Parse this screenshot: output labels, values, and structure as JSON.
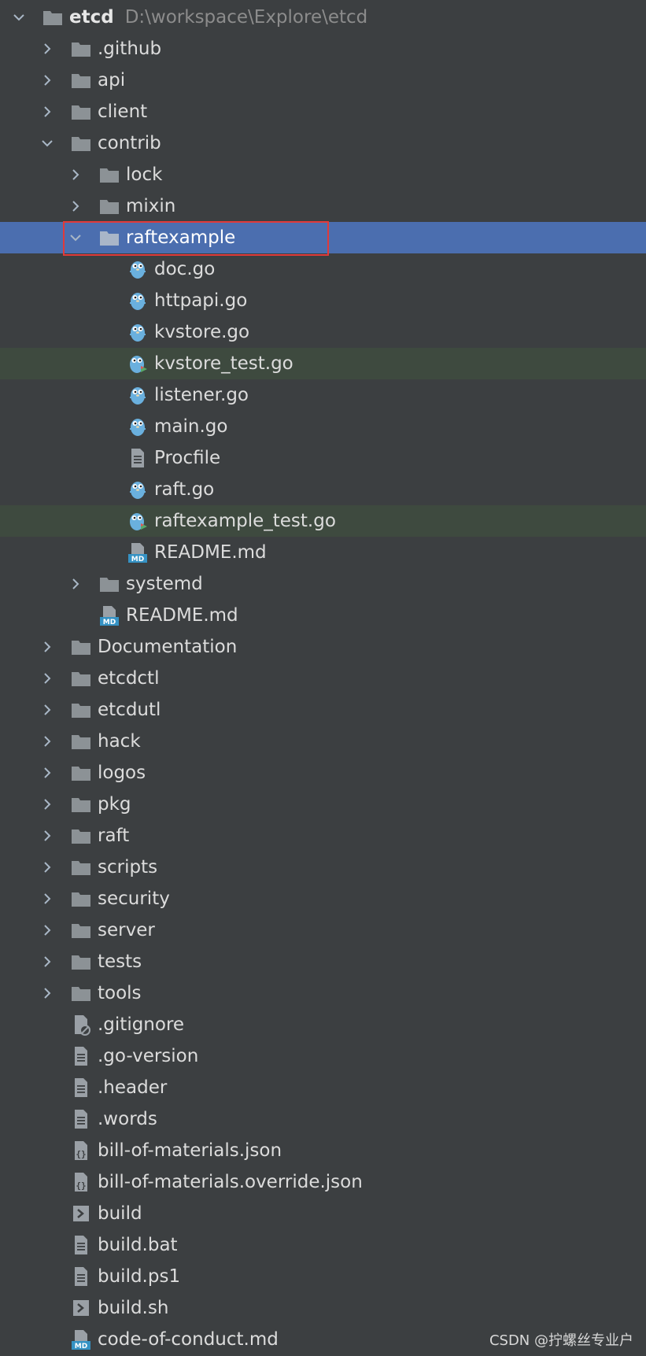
{
  "tree": {
    "root": {
      "name": "etcd",
      "path": "D:\\workspace\\Explore\\etcd"
    },
    "items": [
      {
        "label": ".github",
        "depth": 1,
        "type": "folder",
        "expand": "collapsed"
      },
      {
        "label": "api",
        "depth": 1,
        "type": "folder",
        "expand": "collapsed"
      },
      {
        "label": "client",
        "depth": 1,
        "type": "folder",
        "expand": "collapsed"
      },
      {
        "label": "contrib",
        "depth": 1,
        "type": "folder",
        "expand": "expanded"
      },
      {
        "label": "lock",
        "depth": 2,
        "type": "folder",
        "expand": "collapsed"
      },
      {
        "label": "mixin",
        "depth": 2,
        "type": "folder",
        "expand": "collapsed"
      },
      {
        "label": "raftexample",
        "depth": 2,
        "type": "folder",
        "expand": "expanded",
        "selected": true
      },
      {
        "label": "doc.go",
        "depth": 3,
        "type": "go"
      },
      {
        "label": "httpapi.go",
        "depth": 3,
        "type": "go"
      },
      {
        "label": "kvstore.go",
        "depth": 3,
        "type": "go"
      },
      {
        "label": "kvstore_test.go",
        "depth": 3,
        "type": "gotest",
        "test": true
      },
      {
        "label": "listener.go",
        "depth": 3,
        "type": "go"
      },
      {
        "label": "main.go",
        "depth": 3,
        "type": "go"
      },
      {
        "label": "Procfile",
        "depth": 3,
        "type": "text"
      },
      {
        "label": "raft.go",
        "depth": 3,
        "type": "go"
      },
      {
        "label": "raftexample_test.go",
        "depth": 3,
        "type": "gotest",
        "test": true
      },
      {
        "label": "README.md",
        "depth": 3,
        "type": "md"
      },
      {
        "label": "systemd",
        "depth": 2,
        "type": "folder",
        "expand": "collapsed"
      },
      {
        "label": "README.md",
        "depth": 2,
        "type": "md"
      },
      {
        "label": "Documentation",
        "depth": 1,
        "type": "folder",
        "expand": "collapsed"
      },
      {
        "label": "etcdctl",
        "depth": 1,
        "type": "folder",
        "expand": "collapsed"
      },
      {
        "label": "etcdutl",
        "depth": 1,
        "type": "folder",
        "expand": "collapsed"
      },
      {
        "label": "hack",
        "depth": 1,
        "type": "folder",
        "expand": "collapsed"
      },
      {
        "label": "logos",
        "depth": 1,
        "type": "folder",
        "expand": "collapsed"
      },
      {
        "label": "pkg",
        "depth": 1,
        "type": "folder",
        "expand": "collapsed"
      },
      {
        "label": "raft",
        "depth": 1,
        "type": "folder",
        "expand": "collapsed"
      },
      {
        "label": "scripts",
        "depth": 1,
        "type": "folder",
        "expand": "collapsed"
      },
      {
        "label": "security",
        "depth": 1,
        "type": "folder",
        "expand": "collapsed"
      },
      {
        "label": "server",
        "depth": 1,
        "type": "folder",
        "expand": "collapsed"
      },
      {
        "label": "tests",
        "depth": 1,
        "type": "folder",
        "expand": "collapsed"
      },
      {
        "label": "tools",
        "depth": 1,
        "type": "folder",
        "expand": "collapsed"
      },
      {
        "label": ".gitignore",
        "depth": 1,
        "type": "ignore"
      },
      {
        "label": ".go-version",
        "depth": 1,
        "type": "text"
      },
      {
        "label": ".header",
        "depth": 1,
        "type": "text"
      },
      {
        "label": ".words",
        "depth": 1,
        "type": "text"
      },
      {
        "label": "bill-of-materials.json",
        "depth": 1,
        "type": "json"
      },
      {
        "label": "bill-of-materials.override.json",
        "depth": 1,
        "type": "json"
      },
      {
        "label": "build",
        "depth": 1,
        "type": "shell"
      },
      {
        "label": "build.bat",
        "depth": 1,
        "type": "text"
      },
      {
        "label": "build.ps1",
        "depth": 1,
        "type": "text"
      },
      {
        "label": "build.sh",
        "depth": 1,
        "type": "shell"
      },
      {
        "label": "code-of-conduct.md",
        "depth": 1,
        "type": "md"
      }
    ]
  },
  "watermark": "CSDN @拧螺丝专业户",
  "colors": {
    "background": "#3c3f41",
    "selection": "#4b6eaf",
    "test_row": "#3e4a3f",
    "highlight_border": "#e03a3a",
    "folder": "#8c9296",
    "gopher": "#6ab0de"
  }
}
